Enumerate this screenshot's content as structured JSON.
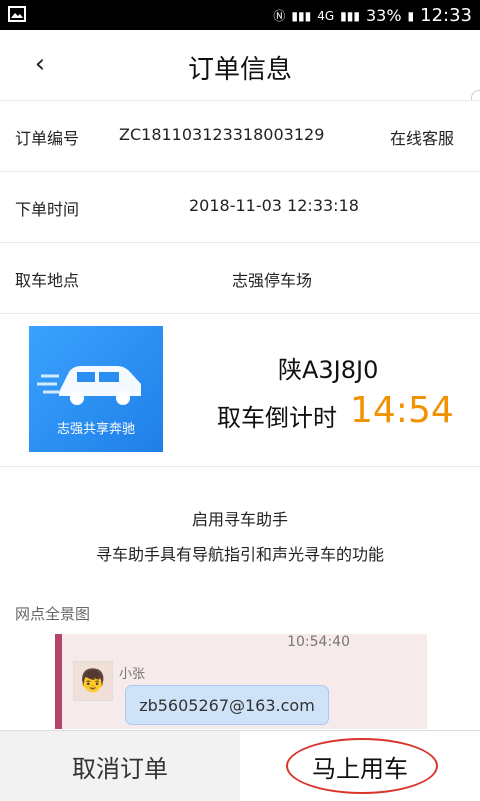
{
  "status_bar": {
    "signal_label": "4G",
    "battery": "33%",
    "time": "12:33"
  },
  "header": {
    "back_icon": "chevron-left-icon",
    "title": "订单信息"
  },
  "order": {
    "number_label": "订单编号",
    "number_value": "ZC181103123318003129",
    "service_label": "在线客服",
    "time_label": "下单时间",
    "time_value": "2018-11-03 12:33:18",
    "pickup_label": "取车地点",
    "pickup_value": "志强停车场"
  },
  "car": {
    "image_text": "志强共享奔驰",
    "plate": "陕A3J8J0",
    "countdown_label": "取车倒计时",
    "countdown_value": "14:54"
  },
  "assistant": {
    "title": "启用寻车助手",
    "description": "寻车助手具有导航指引和声光寻车的功能"
  },
  "panorama": {
    "label": "网点全景图",
    "chat_time": "10:54:40",
    "sender": "小张",
    "message": "zb5605267@163.com"
  },
  "actions": {
    "cancel": "取消订单",
    "use_now": "马上用车"
  },
  "colors": {
    "countdown": "#f29200",
    "car_image": "#1f7fe6",
    "highlight": "#d9342b"
  }
}
